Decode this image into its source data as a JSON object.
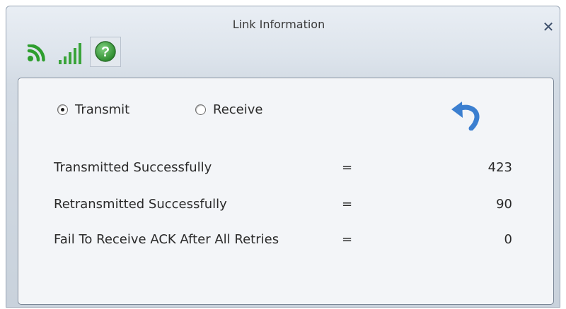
{
  "window": {
    "title": "Link Information",
    "close_label": "✕"
  },
  "toolbar": {
    "icons": [
      "wifi-icon",
      "signal-strength-icon",
      "help-icon"
    ],
    "help_glyph": "?",
    "colors": {
      "wifi": "#2e9e2e",
      "signal": "#3aa43a",
      "help": "#3c9a3c"
    }
  },
  "mode": {
    "transmit_label": "Transmit",
    "receive_label": "Receive",
    "selected": "transmit"
  },
  "refresh": {
    "icon": "undo-arrow-icon",
    "color": "#3b7fd0"
  },
  "stats": [
    {
      "label": "Transmitted Successfully",
      "eq": "=",
      "value": "423"
    },
    {
      "label": "Retransmitted Successfully",
      "eq": "=",
      "value": "90"
    },
    {
      "label": "Fail To Receive ACK After All Retries",
      "eq": "=",
      "value": "0"
    }
  ]
}
